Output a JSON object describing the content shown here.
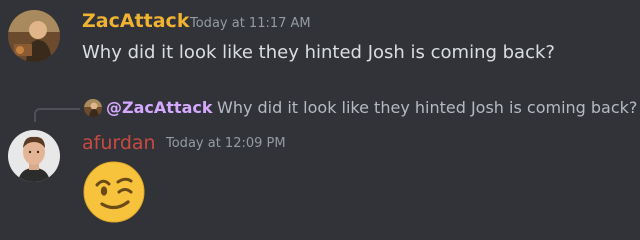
{
  "messages": [
    {
      "username": "ZacAttack",
      "timestamp": "Today at 11:17 AM",
      "content": "Why did it look like they hinted Josh is coming back?",
      "username_color": "#f0b232",
      "avatar": "user-avatar-zacattack"
    },
    {
      "reply": {
        "mention": "@ZacAttack",
        "text": "Why did it look like they hinted Josh is coming back?",
        "avatar": "reply-avatar-zacattack"
      },
      "username": "afurdan",
      "timestamp": "Today at 12:09 PM",
      "username_color": "#c84a42",
      "emoji": "winking-face-emoji",
      "avatar": "user-avatar-afurdan"
    }
  ],
  "theme": {
    "background": "#313338",
    "text": "#dbdee1",
    "muted": "#949ba4"
  }
}
